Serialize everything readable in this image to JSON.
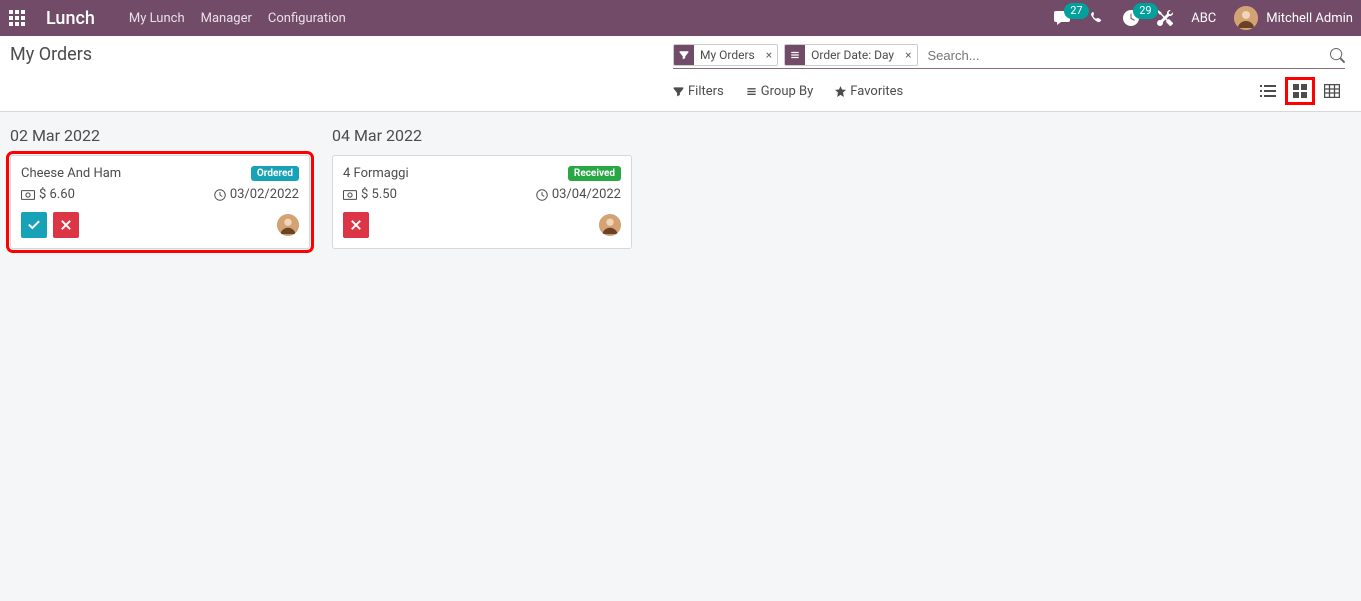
{
  "nav": {
    "brand": "Lunch",
    "items": [
      "My Lunch",
      "Manager",
      "Configuration"
    ],
    "chat_count": "27",
    "activity_count": "29",
    "company": "ABC",
    "user_name": "Mitchell Admin"
  },
  "page": {
    "title": "My Orders",
    "search_placeholder": "Search...",
    "facets": [
      {
        "type": "filter",
        "label": "My Orders"
      },
      {
        "type": "groupby",
        "label": "Order Date: Day"
      }
    ],
    "tools": {
      "filters": "Filters",
      "group_by": "Group By",
      "favorites": "Favorites"
    }
  },
  "kanban": {
    "columns": [
      {
        "title": "02 Mar 2022",
        "cards": [
          {
            "product": "Cheese And Ham",
            "status_label": "Ordered",
            "status_kind": "ordered",
            "price": "$ 6.60",
            "date": "03/02/2022",
            "has_confirm": true,
            "highlighted": true
          }
        ]
      },
      {
        "title": "04 Mar 2022",
        "cards": [
          {
            "product": "4 Formaggi",
            "status_label": "Received",
            "status_kind": "received",
            "price": "$ 5.50",
            "date": "03/04/2022",
            "has_confirm": false,
            "highlighted": false
          }
        ]
      }
    ]
  }
}
